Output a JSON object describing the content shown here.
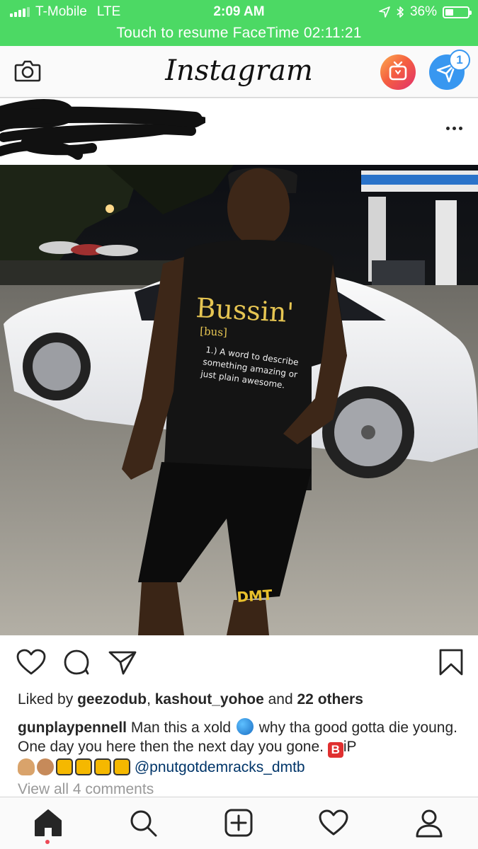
{
  "status_bar": {
    "carrier": "T-Mobile",
    "network": "LTE",
    "time": "2:09 AM",
    "battery": "36%",
    "battery_level": 0.36,
    "facetime_banner": "Touch to resume FaceTime 02:11:21",
    "background_color": "#4cd964"
  },
  "header": {
    "logo": "Instagram",
    "camera_icon": "camera-icon",
    "igtv_icon": "igtv-icon",
    "direct_icon": "paper-plane-icon",
    "direct_badge": "1"
  },
  "post": {
    "shirt_text": {
      "title": "Bussin'",
      "pron": "[bus]",
      "definition_line1": "1.) A word to describe",
      "definition_line2": "something amazing or",
      "definition_line3": "just plain awesome."
    },
    "shorts_logo": "DMT"
  },
  "likes": {
    "prefix": "Liked by ",
    "user1": "geezodub",
    "sep": ", ",
    "user2": "kashout_yohoe",
    "mid": " and ",
    "others": "22 others"
  },
  "caption": {
    "username": "gunplaypennell",
    "text1": " Man this a xold ",
    "text2": " why tha good gotta die young. One day you here then the next day you gone. ",
    "b_emoji": "B",
    "text3": "iP",
    "mention": "@pnutgotdemracks_dmtb"
  },
  "view_all_comments": "View all 4 comments",
  "colors": {
    "link": "#003569",
    "muted": "#999999",
    "dm_blue": "#3897f0",
    "notification_dot": "#ed4956"
  }
}
